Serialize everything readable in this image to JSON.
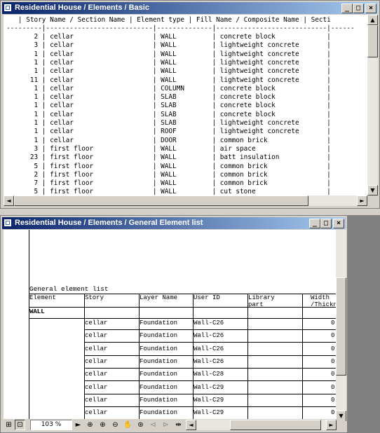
{
  "win1": {
    "title": "Residential House / Elements / Basic",
    "header_line": "   | Story Name / Section Name | Element type | Fill Name / Composite Name | Secti",
    "sep_line": "---------|---------------------------|--------------|----------------------------|------",
    "rows": [
      {
        "qty": "2",
        "story": "cellar",
        "type": "WALL",
        "fill": "concrete block"
      },
      {
        "qty": "3",
        "story": "cellar",
        "type": "WALL",
        "fill": "lightweight concrete"
      },
      {
        "qty": "1",
        "story": "cellar",
        "type": "WALL",
        "fill": "lightweight concrete"
      },
      {
        "qty": "1",
        "story": "cellar",
        "type": "WALL",
        "fill": "lightweight concrete"
      },
      {
        "qty": "1",
        "story": "cellar",
        "type": "WALL",
        "fill": "lightweight concrete"
      },
      {
        "qty": "11",
        "story": "cellar",
        "type": "WALL",
        "fill": "lightweight concrete"
      },
      {
        "qty": "1",
        "story": "cellar",
        "type": "COLUMN",
        "fill": "concrete block"
      },
      {
        "qty": "1",
        "story": "cellar",
        "type": "SLAB",
        "fill": "concrete block"
      },
      {
        "qty": "1",
        "story": "cellar",
        "type": "SLAB",
        "fill": "concrete block"
      },
      {
        "qty": "1",
        "story": "cellar",
        "type": "SLAB",
        "fill": "concrete block"
      },
      {
        "qty": "1",
        "story": "cellar",
        "type": "SLAB",
        "fill": "lightweight concrete"
      },
      {
        "qty": "1",
        "story": "cellar",
        "type": "ROOF",
        "fill": "lightweight concrete"
      },
      {
        "qty": "1",
        "story": "cellar",
        "type": "DOOR",
        "fill": "common brick"
      },
      {
        "qty": "3",
        "story": "first floor",
        "type": "WALL",
        "fill": "air space"
      },
      {
        "qty": "23",
        "story": "first floor",
        "type": "WALL",
        "fill": "batt insulation"
      },
      {
        "qty": "5",
        "story": "first floor",
        "type": "WALL",
        "fill": "common brick"
      },
      {
        "qty": "2",
        "story": "first floor",
        "type": "WALL",
        "fill": "common brick"
      },
      {
        "qty": "7",
        "story": "first floor",
        "type": "WALL",
        "fill": "common brick"
      },
      {
        "qty": "5",
        "story": "first floor",
        "type": "WALL",
        "fill": "cut stone"
      }
    ]
  },
  "win2": {
    "title": "Residential House / Elements / General Element list",
    "list_title": "General element list",
    "columns": {
      "element": "Element",
      "story": "Story",
      "layer": "Layer Name",
      "user_id": "User ID",
      "library": "Library\npart",
      "width": "Width\n/Thickn"
    },
    "group": "WALL",
    "rows": [
      {
        "story": "cellar",
        "layer": "Foundation",
        "user_id": "Wall-C26",
        "width": "0"
      },
      {
        "story": "cellar",
        "layer": "Foundation",
        "user_id": "Wall-C26",
        "width": "0"
      },
      {
        "story": "cellar",
        "layer": "Foundation",
        "user_id": "Wall-C26",
        "width": "0"
      },
      {
        "story": "cellar",
        "layer": "Foundation",
        "user_id": "Wall-C26",
        "width": "0"
      },
      {
        "story": "cellar",
        "layer": "Foundation",
        "user_id": "Wall-C28",
        "width": "0"
      },
      {
        "story": "cellar",
        "layer": "Foundation",
        "user_id": "Wall-C29",
        "width": "0"
      },
      {
        "story": "cellar",
        "layer": "Foundation",
        "user_id": "Wall-C29",
        "width": "0"
      },
      {
        "story": "cellar",
        "layer": "Foundation",
        "user_id": "Wall-C29",
        "width": "0"
      }
    ],
    "zoom": "103 %"
  },
  "icons": {
    "minimize": "_",
    "maximize": "□",
    "close": "×",
    "up": "▲",
    "down": "▼",
    "left": "◄",
    "right": "►"
  }
}
